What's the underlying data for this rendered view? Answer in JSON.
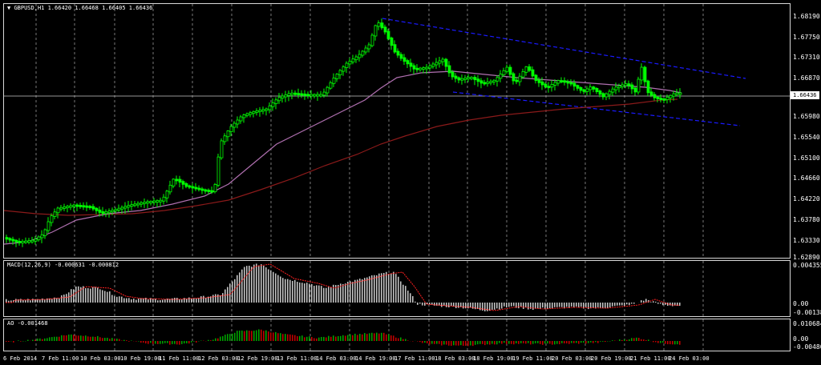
{
  "main_chart": {
    "symbol": "GBPUSD,H1",
    "ohlc": {
      "open": "1.66420",
      "high": "1.66468",
      "low": "1.66405",
      "close": "1.66436"
    },
    "current_price": "1.66436",
    "price_axis": [
      "1.68190",
      "1.67750",
      "1.67310",
      "1.66870",
      "1.65980",
      "1.65540",
      "1.65100",
      "1.64660",
      "1.64220",
      "1.63780",
      "1.63330",
      "1.62890"
    ],
    "colors": {
      "bull_candle": "#00ff00",
      "ma_fast": "#b070b0",
      "ma_slow": "#8b1a1a",
      "channel": "#1a1aff",
      "grid": "#c8c8c8"
    }
  },
  "macd": {
    "title": "MACD(12,26,9) -0.000631 -0.000812",
    "axis": [
      "0.004355",
      "0.00",
      "-0.001385"
    ],
    "colors": {
      "histogram": "#c0c0c0",
      "signal": "#ff2020"
    }
  },
  "ao": {
    "title": "AO -0.001468",
    "axis": [
      "0.010684",
      "0.00",
      "-0.004805"
    ],
    "colors": {
      "up": "#00a000",
      "down": "#c00000"
    }
  },
  "timeline": [
    "6 Feb 2014",
    "7 Feb 11:00",
    "10 Feb 03:00",
    "10 Feb 19:00",
    "11 Feb 11:00",
    "12 Feb 03:00",
    "12 Feb 19:00",
    "13 Feb 11:00",
    "14 Feb 03:00",
    "14 Feb 19:00",
    "17 Feb 11:00",
    "18 Feb 03:00",
    "18 Feb 19:00",
    "19 Feb 11:00",
    "20 Feb 03:00",
    "20 Feb 19:00",
    "21 Feb 11:00",
    "24 Feb 03:00"
  ]
}
